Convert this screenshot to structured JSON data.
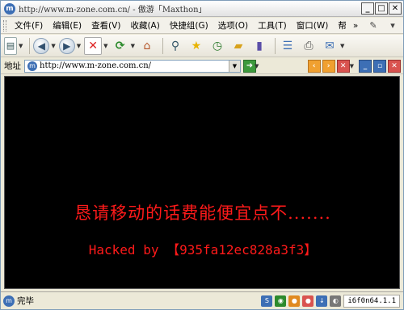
{
  "window": {
    "title": "http://www.m-zone.com.cn/ - 傲游「Maxthon」",
    "buttons": [
      "_",
      "□",
      "✕"
    ]
  },
  "menu": {
    "items": [
      "文件(F)",
      "编辑(E)",
      "查看(V)",
      "收藏(A)",
      "快捷组(G)",
      "选项(O)",
      "工具(T)",
      "窗口(W)",
      "帮"
    ],
    "more": "»"
  },
  "toolbar": {
    "buttons": [
      "new-page",
      "back",
      "forward",
      "stop",
      "refresh",
      "home",
      "search",
      "favorites",
      "history",
      "folder",
      "book",
      "list",
      "print",
      "mail"
    ]
  },
  "address": {
    "label": "地址",
    "url": "http://www.m-zone.com.cn/"
  },
  "content": {
    "message": "恳请移动的话费能便宜点不.......",
    "hacked_by": "Hacked by 【935fa12ec828a3f3】",
    "background": "#000000",
    "text_color": "#ff1a1a"
  },
  "status": {
    "text": "完毕",
    "panel": "i6f0n64.1.1"
  }
}
